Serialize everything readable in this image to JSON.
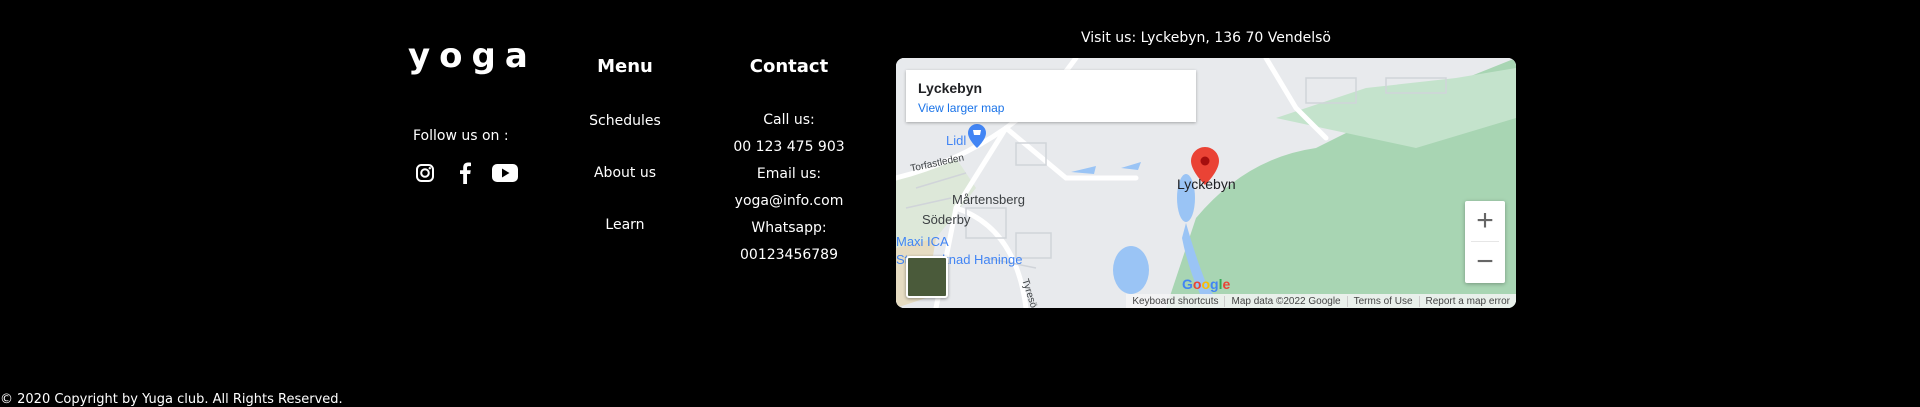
{
  "brand": {
    "logo_text": "yoga"
  },
  "social": {
    "follow_label": "Follow us on :",
    "icons": [
      "instagram-icon",
      "facebook-icon",
      "youtube-icon"
    ]
  },
  "menu": {
    "heading": "Menu",
    "items": [
      "Schedules",
      "About us",
      "Learn"
    ]
  },
  "contact": {
    "heading": "Contact",
    "call_label": "Call us:",
    "phone": "00 123 475 903",
    "email_label": "Email us:",
    "email": "yoga@info.com",
    "whatsapp_label": "Whatsapp:",
    "whatsapp": "00123456789"
  },
  "map": {
    "visit_text": "Visit us: Lyckebyn, 136 70 Vendelsö",
    "place_title": "Lyckebyn",
    "larger_map_link": "View larger map",
    "labels": {
      "lidl": "Lidl",
      "torfastleden": "Torfastleden",
      "martensberg": "Mårtensberg",
      "soderby": "Söderby",
      "maxi_ica": "Maxi ICA",
      "handen": "Stormarknad Haninge",
      "tyreso": "Tyresö",
      "lyckebyn": "Lyckebyn"
    },
    "zoom_in": "+",
    "zoom_out": "−",
    "google_letters": [
      "G",
      "o",
      "o",
      "g",
      "l",
      "e"
    ],
    "google_colors": [
      "#4285f4",
      "#ea4335",
      "#fbbc05",
      "#4285f4",
      "#34a853",
      "#ea4335"
    ],
    "attribution": [
      "Keyboard shortcuts",
      "Map data ©2022 Google",
      "Terms of Use",
      "Report a map error"
    ]
  },
  "footer": {
    "copyright": "© 2020 Copyright by Yuga club. All Rights Reserved."
  }
}
